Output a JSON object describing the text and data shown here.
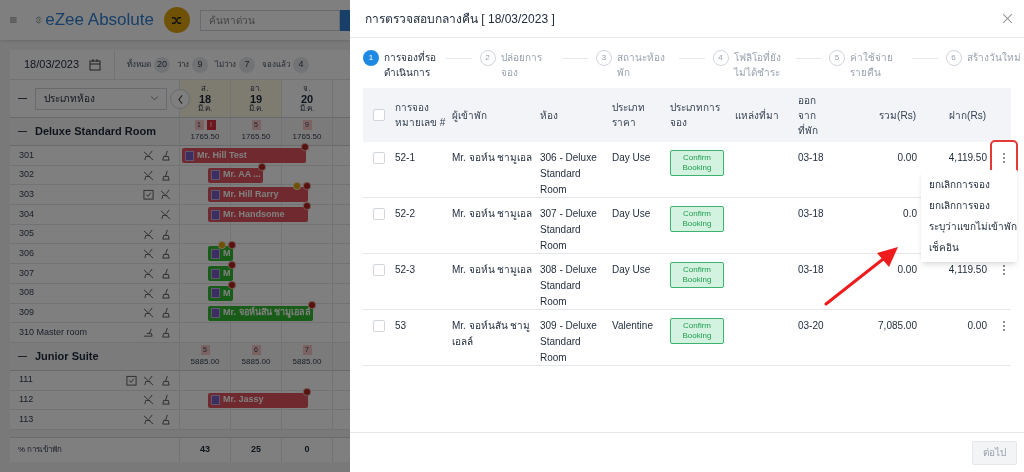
{
  "app": {
    "brand": "eZee Absolute",
    "search": {
      "placeholder": "ค้นหาด่วน"
    }
  },
  "date": "18/03/2023",
  "counts": [
    {
      "label": "ทั้งหมด",
      "value": "20"
    },
    {
      "label": "ว่าง",
      "value": "9"
    },
    {
      "label": "ไม่ว่าง",
      "value": "7"
    },
    {
      "label": "จองแล้ว",
      "value": "4"
    }
  ],
  "filter": {
    "value": "ประเภทห้อง"
  },
  "days": [
    {
      "weekday": "ส.",
      "day": "18",
      "month": "มี.ค.",
      "weekend": true
    },
    {
      "weekday": "อา.",
      "day": "19",
      "month": "มี.ค.",
      "weekend": true
    },
    {
      "weekday": "จ.",
      "day": "20",
      "month": "มี.ค.",
      "weekend": false
    }
  ],
  "groups": [
    {
      "name": "Deluxe Standard Room",
      "summary": [
        {
          "badges": [
            {
              "text": "1",
              "kind": "count"
            },
            {
              "text": "!",
              "kind": "alert"
            }
          ],
          "rate": "1765.50"
        },
        {
          "badges": [
            {
              "text": "5",
              "kind": "count"
            }
          ],
          "rate": "1765.50"
        },
        {
          "badges": [
            {
              "text": "9",
              "kind": "count"
            }
          ],
          "rate": "1765.50"
        }
      ],
      "rooms": [
        {
          "name": "301",
          "icons": [
            {
              "kind": "no_clean"
            },
            {
              "kind": "clean"
            }
          ],
          "booking": {
            "guest": "Mr. Hill Test",
            "kind": "occupied",
            "cells": [
              {
                "kind": "full"
              },
              {
                "kind": "full"
              },
              {
                "kind": "am"
              }
            ],
            "marks": [
              {
                "kind": "dollar"
              }
            ]
          }
        },
        {
          "name": "302",
          "icons": [
            {
              "kind": "no_clean"
            },
            {
              "kind": "clean"
            }
          ],
          "booking": {
            "guest": "Mr. AA ...",
            "kind": "occupied",
            "cells": [
              {
                "kind": "pm"
              },
              {
                "kind": "am"
              }
            ],
            "marks": [
              {
                "kind": "dollar"
              }
            ]
          }
        },
        {
          "name": "303",
          "icons": [
            {
              "kind": "checklist"
            },
            {
              "kind": "no_clean"
            }
          ],
          "booking": {
            "guest": "Mr. Hill Rarry",
            "kind": "occupied",
            "cells": [
              {
                "kind": "pm"
              },
              {
                "kind": "full"
              },
              {
                "kind": "am"
              }
            ],
            "marks": [
              {
                "kind": "crown"
              },
              {
                "kind": "dollar"
              }
            ]
          }
        },
        {
          "name": "304",
          "icons": [
            {
              "kind": "no_clean"
            }
          ],
          "booking": {
            "guest": "Mr. Handsome",
            "kind": "occupied",
            "cells": [
              {
                "kind": "pm"
              },
              {
                "kind": "full"
              },
              {
                "kind": "am"
              }
            ],
            "marks": [
              {
                "kind": "dollar"
              }
            ]
          }
        },
        {
          "name": "305",
          "icons": [
            {
              "kind": "no_clean"
            },
            {
              "kind": "clean"
            }
          ]
        },
        {
          "name": "306",
          "icons": [
            {
              "kind": "no_clean"
            },
            {
              "kind": "clean"
            }
          ],
          "booking": {
            "guest": "M",
            "kind": "day_use",
            "cells": [
              {
                "kind": "pm"
              }
            ],
            "marks": [
              {
                "kind": "crown"
              },
              {
                "kind": "dollar"
              }
            ]
          }
        },
        {
          "name": "307",
          "icons": [
            {
              "kind": "no_clean"
            },
            {
              "kind": "clean"
            }
          ],
          "booking": {
            "guest": "M",
            "kind": "day_use",
            "cells": [
              {
                "kind": "pm"
              }
            ],
            "marks": [
              {
                "kind": "dollar"
              }
            ]
          }
        },
        {
          "name": "308",
          "icons": [
            {
              "kind": "no_clean"
            },
            {
              "kind": "clean"
            }
          ],
          "booking": {
            "guest": "M",
            "kind": "day_use",
            "cells": [
              {
                "kind": "pm"
              }
            ],
            "marks": [
              {
                "kind": "dollar"
              }
            ]
          }
        },
        {
          "name": "309",
          "icons": [
            {
              "kind": "no_clean"
            },
            {
              "kind": "clean"
            }
          ],
          "booking": {
            "guest": "Mr. จอห์นสัน ชามูเอลล์",
            "kind": "day_use",
            "cells": [
              {
                "kind": "pm"
              },
              {
                "kind": "full"
              },
              {
                "kind": "am"
              }
            ],
            "marks": [
              {
                "kind": "dollar"
              }
            ]
          }
        },
        {
          "name": "310 Master room",
          "icons": [
            {
              "kind": "dirty"
            },
            {
              "kind": "clean"
            }
          ]
        }
      ]
    },
    {
      "name": "Junior Suite",
      "summary": [
        {
          "badges": [
            {
              "text": "5",
              "kind": "count"
            }
          ],
          "rate": "5885.00"
        },
        {
          "badges": [
            {
              "text": "6",
              "kind": "count"
            }
          ],
          "rate": "5885.00"
        },
        {
          "badges": [
            {
              "text": "7",
              "kind": "count"
            }
          ],
          "rate": "5885.00"
        }
      ],
      "rooms": [
        {
          "name": "111",
          "icons": [
            {
              "kind": "checklist"
            },
            {
              "kind": "no_clean"
            },
            {
              "kind": "clean"
            }
          ]
        },
        {
          "name": "112",
          "icons": [
            {
              "kind": "no_clean"
            },
            {
              "kind": "clean"
            }
          ],
          "booking": {
            "guest": "Mr. Jassy",
            "kind": "occupied",
            "cells": [
              {
                "kind": "pm"
              },
              {
                "kind": "full"
              },
              {
                "kind": "am"
              }
            ],
            "marks": [
              {
                "kind": "dollar"
              }
            ]
          }
        },
        {
          "name": "113",
          "icons": [
            {
              "kind": "no_clean"
            },
            {
              "kind": "clean"
            }
          ]
        }
      ]
    }
  ],
  "occupancy": {
    "label": "% การเข้าพัก",
    "values": [
      "43",
      "25",
      "0"
    ]
  },
  "dialog": {
    "title": "การตรวจสอบกลางคืน [ 18/03/2023 ]",
    "steps": [
      {
        "number": "1",
        "label": "การจองที่รอดำเนินการ",
        "selected": true
      },
      {
        "number": "2",
        "label": "ปล่อยการจอง",
        "selected": false
      },
      {
        "number": "3",
        "label": "สถานะห้องพัก",
        "selected": false
      },
      {
        "number": "4",
        "label": "โฟลิโอที่ยังไม่ได้ชำระ",
        "selected": false
      },
      {
        "number": "5",
        "label": "ค่าใช้จ่ายรายคืน",
        "selected": false
      },
      {
        "number": "6",
        "label": "สร้างวันใหม่",
        "selected": false
      }
    ],
    "select_all": {
      "checked": false
    },
    "columns": [
      "การจอง หมายเลข #",
      "ผู้เข้าพัก",
      "ห้อง",
      "ประเภท ราคา",
      "ประเภทการ จอง",
      "แหล่งที่มา",
      "ออก จาก ที่พัก",
      "รวม(Rs)",
      "ฝาก(Rs)"
    ],
    "rows": [
      {
        "checked": false,
        "booking_no": "52-1",
        "guest": "Mr. จอห์น ชามูเอล",
        "room": "306 - Deluxe Standard Room",
        "rate_type": "Day Use",
        "booking_type": "Confirm Booking",
        "checkout": "03-18",
        "total": "0.00",
        "deposit": "4,119.50",
        "menu_button": true,
        "menu_open": true,
        "highlighted": true
      },
      {
        "checked": false,
        "booking_no": "52-2",
        "guest": "Mr. จอห์น ชามูเอล",
        "room": "307 - Deluxe Standard Room",
        "rate_type": "Day Use",
        "booking_type": "Confirm Booking",
        "checkout": "03-18",
        "total": "0.0",
        "menu_button": false,
        "menu_open": false,
        "highlighted": false
      },
      {
        "checked": false,
        "booking_no": "52-3",
        "guest": "Mr. จอห์น ชามูเอล",
        "room": "308 - Deluxe Standard Room",
        "rate_type": "Day Use",
        "booking_type": "Confirm Booking",
        "checkout": "03-18",
        "total": "0.00",
        "deposit": "4,119.50",
        "menu_button": true,
        "menu_open": false,
        "highlighted": false
      },
      {
        "checked": false,
        "booking_no": "53",
        "guest": "Mr. จอห์นสัน ชามูเอลล์",
        "room": "309 - Deluxe Standard Room",
        "rate_type": "Valentine",
        "booking_type": "Confirm Booking",
        "checkout": "03-20",
        "total": "7,085.00",
        "deposit": "0.00",
        "menu_button": true,
        "menu_open": false,
        "highlighted": false
      }
    ],
    "row_menu": [
      "ยกเลิกการจอง",
      "ยกเลิกการจอง",
      "ระบุว่าแขกไม่เข้าพัก",
      "เช็คอิน"
    ],
    "pointer_arrow": true,
    "next_button": {
      "label": "ต่อไป",
      "disabled": true
    }
  }
}
